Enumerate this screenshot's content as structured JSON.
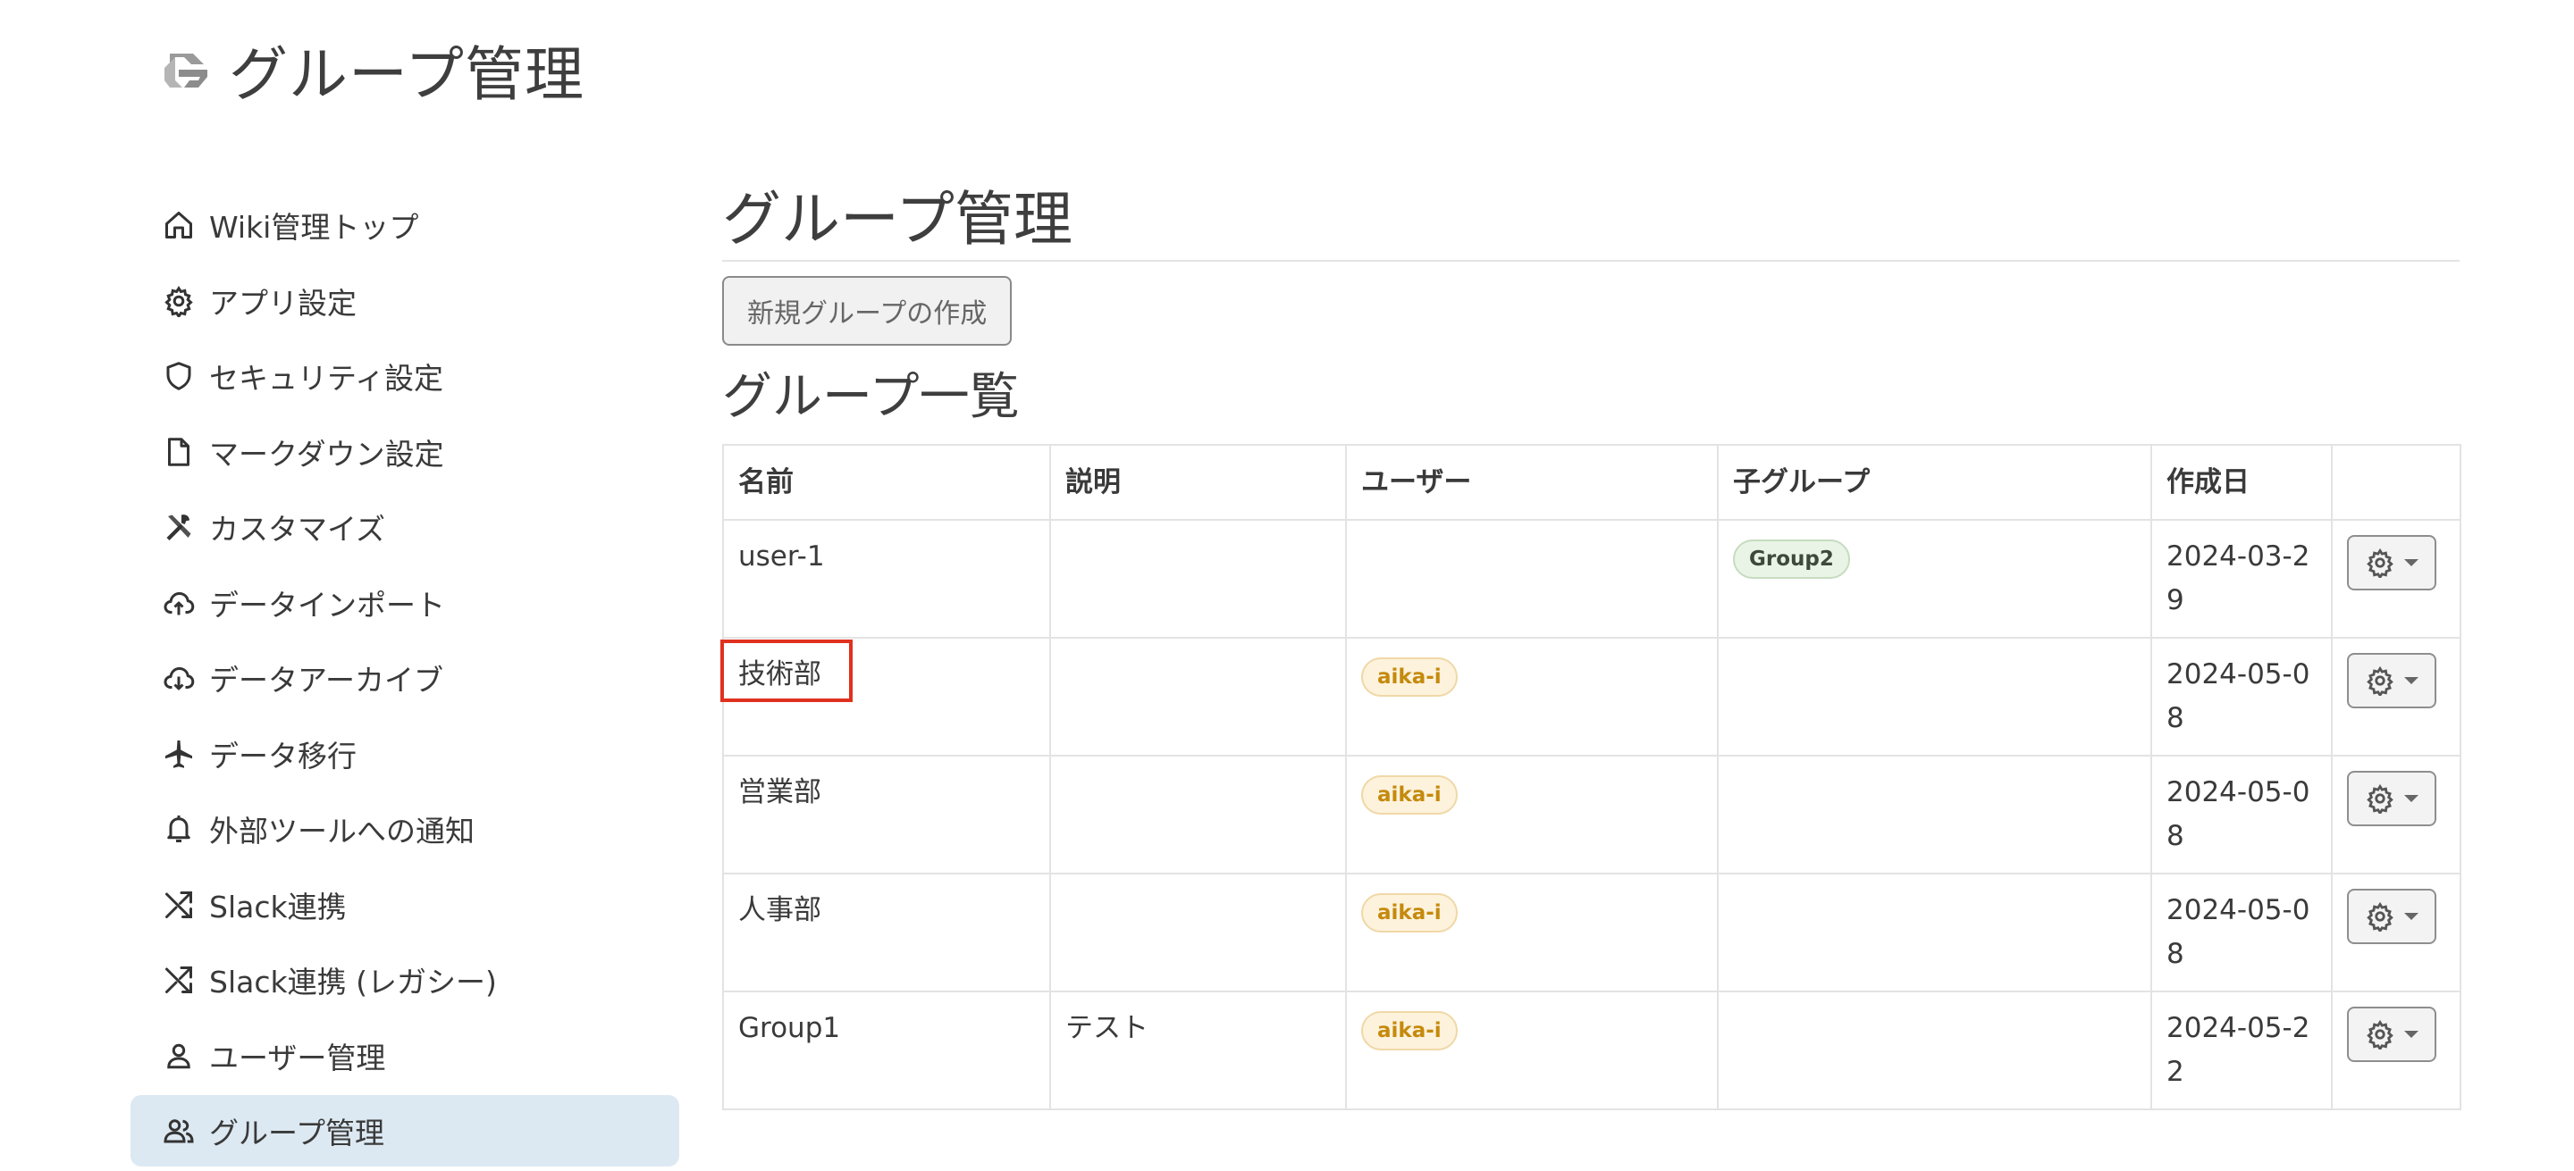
{
  "header": {
    "title": "グループ管理",
    "logo_icon": "growi-logo-icon"
  },
  "sidebar": {
    "items": [
      {
        "label": "Wiki管理トップ",
        "icon": "home-icon"
      },
      {
        "label": "アプリ設定",
        "icon": "gear-icon"
      },
      {
        "label": "セキュリティ設定",
        "icon": "shield-icon"
      },
      {
        "label": "マークダウン設定",
        "icon": "document-icon"
      },
      {
        "label": "カスタマイズ",
        "icon": "tools-icon"
      },
      {
        "label": "データインポート",
        "icon": "cloud-upload-icon"
      },
      {
        "label": "データアーカイブ",
        "icon": "cloud-download-icon"
      },
      {
        "label": "データ移行",
        "icon": "airplane-icon"
      },
      {
        "label": "外部ツールへの通知",
        "icon": "bell-icon"
      },
      {
        "label": "Slack連携",
        "icon": "shuffle-icon"
      },
      {
        "label": "Slack連携 (レガシー)",
        "icon": "shuffle-icon"
      },
      {
        "label": "ユーザー管理",
        "icon": "user-icon"
      },
      {
        "label": "グループ管理",
        "icon": "users-icon",
        "active": true
      }
    ]
  },
  "main": {
    "title": "グループ管理",
    "new_group_button": "新規グループの作成",
    "list_title": "グループ一覧",
    "table": {
      "headers": [
        "名前",
        "説明",
        "ユーザー",
        "子グループ",
        "作成日",
        ""
      ],
      "rows": [
        {
          "name": "user-1",
          "description": "",
          "users": [],
          "children": [
            "Group2"
          ],
          "created": "2024-03-29"
        },
        {
          "name": "技術部",
          "description": "",
          "users": [
            "aika-i"
          ],
          "children": [],
          "created": "2024-05-08"
        },
        {
          "name": "営業部",
          "description": "",
          "users": [
            "aika-i"
          ],
          "children": [],
          "created": "2024-05-08"
        },
        {
          "name": "人事部",
          "description": "",
          "users": [
            "aika-i"
          ],
          "children": [],
          "created": "2024-05-08"
        },
        {
          "name": "Group1",
          "description": "テスト",
          "users": [
            "aika-i"
          ],
          "children": [],
          "created": "2024-05-22"
        }
      ]
    }
  },
  "colors": {
    "accent_active_bg": "#dde9f2",
    "highlight_border": "#e0301e",
    "user_badge": "#c58a0d",
    "group_badge_bg": "#e9f4e6"
  }
}
